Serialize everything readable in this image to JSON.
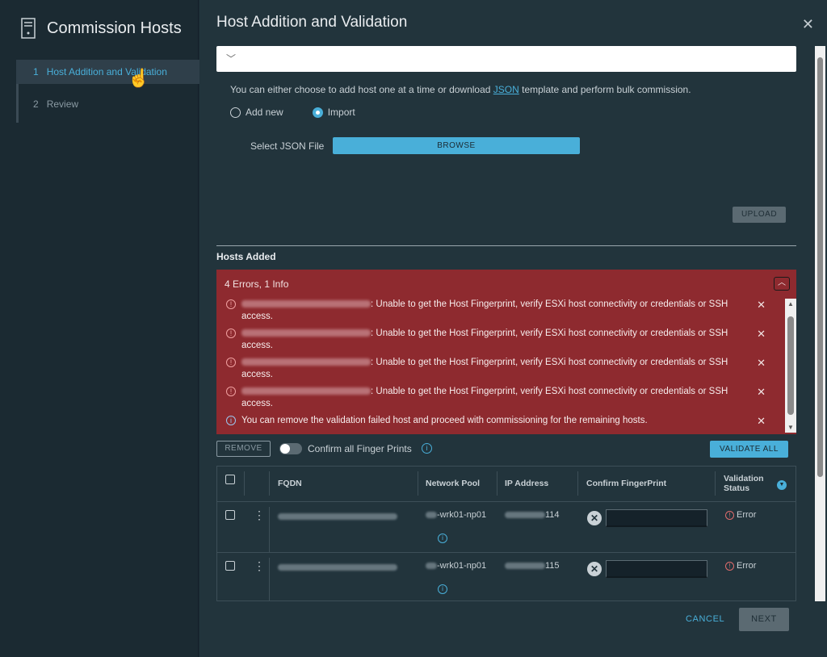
{
  "sidebar": {
    "title": "Commission Hosts",
    "steps": [
      {
        "num": "1",
        "label": "Host Addition and Validation"
      },
      {
        "num": "2",
        "label": "Review"
      }
    ]
  },
  "main": {
    "title": "Host Addition and Validation",
    "description_pre": "You can either choose to add host one at a time or download ",
    "description_link": "JSON",
    "description_post": " template and perform bulk commission.",
    "radio_add_new": "Add new",
    "radio_import": "Import",
    "select_json_label": "Select JSON File",
    "browse_label": "BROWSE",
    "upload_label": "UPLOAD",
    "hosts_added_label": "Hosts Added"
  },
  "alert": {
    "summary": "4 Errors, 1 Info",
    "items": [
      {
        "type": "error",
        "text": ": Unable to get the Host Fingerprint, verify ESXi host connectivity or credentials or SSH access."
      },
      {
        "type": "error",
        "text": ": Unable to get the Host Fingerprint, verify ESXi host connectivity or credentials or SSH access."
      },
      {
        "type": "error",
        "text": ": Unable to get the Host Fingerprint, verify ESXi host connectivity or credentials or SSH access."
      },
      {
        "type": "error",
        "text": ": Unable to get the Host Fingerprint, verify ESXi host connectivity or credentials or SSH access."
      },
      {
        "type": "info",
        "text": "You can remove the validation failed host and proceed with commissioning for the remaining hosts."
      }
    ]
  },
  "toolbar": {
    "remove_label": "REMOVE",
    "confirm_all_label": "Confirm all Finger Prints",
    "validate_all_label": "VALIDATE ALL"
  },
  "grid": {
    "columns": {
      "fqdn": "FQDN",
      "network_pool": "Network Pool",
      "ip_address": "IP Address",
      "confirm_fp": "Confirm FingerPrint",
      "validation_status_1": "Validation",
      "validation_status_2": "Status"
    },
    "rows": [
      {
        "network_pool": "-wrk01-np01",
        "ip_suffix": "114",
        "status": "Error"
      },
      {
        "network_pool": "-wrk01-np01",
        "ip_suffix": "115",
        "status": "Error"
      }
    ]
  },
  "footer": {
    "cancel_label": "CANCEL",
    "next_label": "NEXT"
  },
  "colors": {
    "accent": "#49afd9",
    "alert_bg": "#8e2a2f",
    "panel_bg": "#22343c",
    "sidebar_bg": "#1b2a32"
  }
}
